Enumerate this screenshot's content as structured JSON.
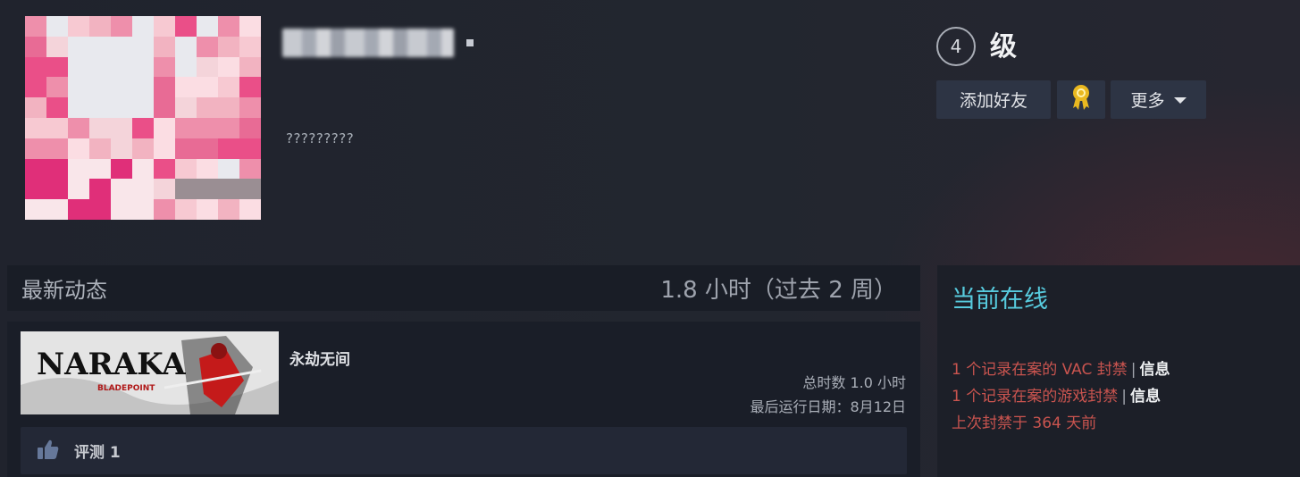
{
  "profile": {
    "summary": "?????????",
    "level_number": "4",
    "level_label": "级"
  },
  "actions": {
    "add_friend": "添加好友",
    "award_icon": "award-icon",
    "more": "更多"
  },
  "activity": {
    "title": "最新动态",
    "hours_summary": "1.8 小时（过去 2 周）",
    "game": {
      "name": "永劫无间",
      "capsule_title": "NARAKA",
      "capsule_subtitle": "BLADEPOINT",
      "total_playtime": "总时数 1.0 小时",
      "last_played": "最后运行日期：8月12日",
      "review_icon": "thumbs-up-icon",
      "review_label": "评测 1"
    }
  },
  "status": {
    "title": "当前在线",
    "bans": [
      {
        "text": "1 个记录在案的 VAC 封禁",
        "sep": "|",
        "info": "信息"
      },
      {
        "text": "1 个记录在案的游戏封禁",
        "sep": "|",
        "info": "信息"
      },
      {
        "text": "上次封禁于 364 天前"
      }
    ]
  },
  "colors": {
    "accent_online": "#57cbde",
    "ban_red": "#c9544f",
    "button_bg": "#2d3444",
    "award_gold": "#e9b820"
  }
}
